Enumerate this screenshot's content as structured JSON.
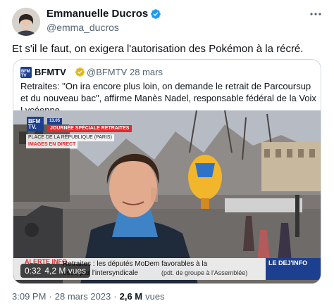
{
  "author": {
    "name": "Emmanuelle Ducros",
    "handle": "@emma_ducros",
    "verified_color": "#1d9bf0"
  },
  "more_icon": "more-horizontal-icon",
  "tweet": {
    "text": "Et s'il le faut, on exigera l'autorisation des Pokémon à la récré."
  },
  "quote": {
    "logo_text": "BFM TV",
    "name": "BFMTV",
    "verified_color": "#e2b719",
    "handle": "@BFMTV",
    "separator": "·",
    "date": "28 mars",
    "text": "Retraites: \"On ira encore plus loin, on demande le retrait de Parcoursup et du nouveau bac\", affirme Manès Nadel, responsable fédéral de la Voix Lycéenne",
    "video": {
      "badge": "BFM TV.",
      "time": "13.05",
      "banner": "JOURNÉE SPÉCIALE RETRAITES",
      "place": "PLACE DE LA RÉPUBLIQUE (PARIS)",
      "live": "IMAGES EN DIRECT",
      "alert": "ALERTE INFO",
      "ticker_line1": "Retraites : les députés MoDem favorables à la",
      "ticker_line2": "osée par l'intersyndicale",
      "ticker_line2b": "(pdt. de groupe à l'Assemblée)",
      "ticker_right": "LE DEJ'INFO",
      "duration": "0:32",
      "views": "4,2 M vues"
    }
  },
  "meta": {
    "time": "3:09 PM",
    "separator": "·",
    "date": "28 mars 2023",
    "separator2": "·",
    "views_count": "2,6 M",
    "views_label": "vues"
  }
}
